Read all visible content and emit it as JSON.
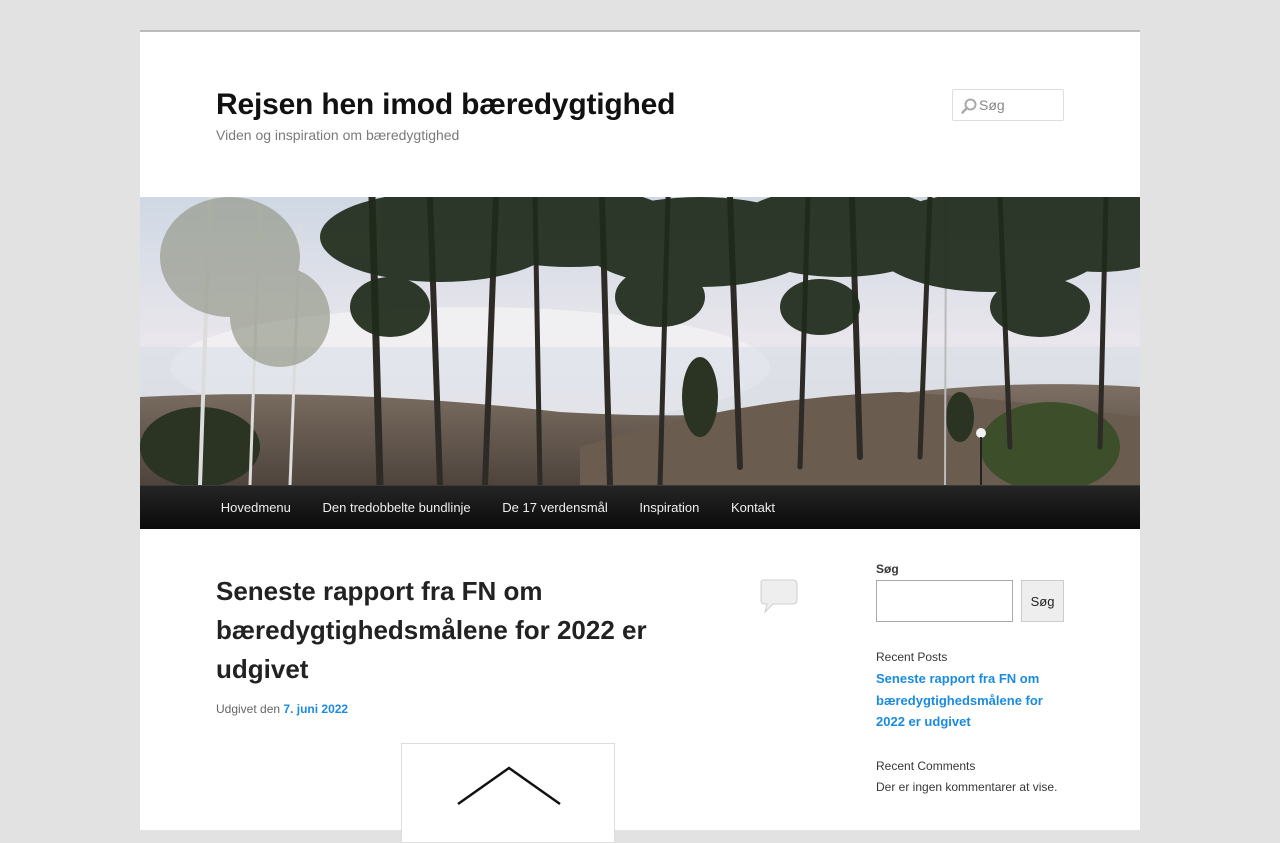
{
  "header": {
    "site_title": "Rejsen hen imod bæredygtighed",
    "site_description": "Viden og inspiration om bæredygtighed",
    "search_placeholder": "Søg"
  },
  "nav": {
    "items": [
      "Hovedmenu",
      "Den tredobbelte bundlinje",
      "De 17 verdensmål",
      "Inspiration",
      "Kontakt"
    ]
  },
  "post": {
    "title": "Seneste rapport fra FN om bæredygtighedsmålene for 2022 er udgivet",
    "meta_prefix": "Udgivet den",
    "date": "7. juni 2022"
  },
  "sidebar": {
    "search_label": "Søg",
    "search_button": "Søg",
    "recent_posts_heading": "Recent Posts",
    "recent_posts": [
      "Seneste rapport fra FN om bæredygtighedsmålene for 2022 er udgivet"
    ],
    "recent_comments_heading": "Recent Comments",
    "no_comments_text": "Der er ingen kommentarer at vise."
  },
  "colors": {
    "link": "#1b8be0",
    "nav_bg": "#1a1a1a",
    "page_bg": "#e2e2e2"
  },
  "icons": {
    "search": "search-icon",
    "comment": "comment-bubble-icon"
  }
}
